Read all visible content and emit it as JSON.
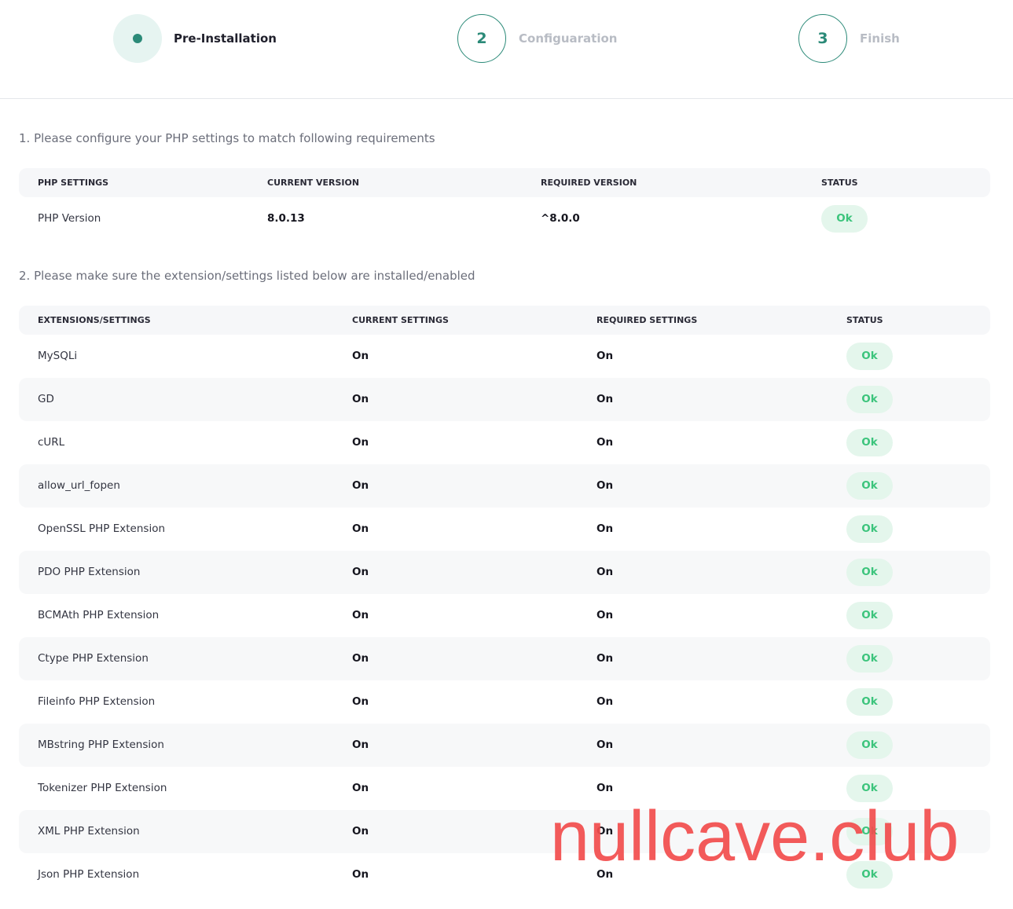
{
  "stepper": {
    "steps": [
      {
        "label": "Pre-Installation",
        "state": "active"
      },
      {
        "number": "2",
        "label": "Configuaration",
        "state": "pending"
      },
      {
        "number": "3",
        "label": "Finish",
        "state": "pending"
      }
    ]
  },
  "php_section": {
    "title": "1.  Please configure your PHP settings to match following requirements",
    "headers": [
      "PHP SETTINGS",
      "CURRENT VERSION",
      "REQUIRED VERSION",
      "STATUS"
    ],
    "row": {
      "setting": "PHP Version",
      "current": "8.0.13",
      "required": "^8.0.0",
      "status": "Ok"
    }
  },
  "ext_section": {
    "title": "2. Please make sure the extension/settings listed below are installed/enabled",
    "headers": [
      "EXTENSIONS/SETTINGS",
      "CURRENT SETTINGS",
      "REQUIRED SETTINGS",
      "STATUS"
    ],
    "rows": [
      {
        "name": "MySQLi",
        "current": "On",
        "required": "On",
        "status": "Ok"
      },
      {
        "name": "GD",
        "current": "On",
        "required": "On",
        "status": "Ok"
      },
      {
        "name": "cURL",
        "current": "On",
        "required": "On",
        "status": "Ok"
      },
      {
        "name": "allow_url_fopen",
        "current": "On",
        "required": "On",
        "status": "Ok"
      },
      {
        "name": "OpenSSL PHP Extension",
        "current": "On",
        "required": "On",
        "status": "Ok"
      },
      {
        "name": "PDO PHP Extension",
        "current": "On",
        "required": "On",
        "status": "Ok"
      },
      {
        "name": "BCMAth PHP Extension",
        "current": "On",
        "required": "On",
        "status": "Ok"
      },
      {
        "name": "Ctype PHP Extension",
        "current": "On",
        "required": "On",
        "status": "Ok"
      },
      {
        "name": "Fileinfo PHP Extension",
        "current": "On",
        "required": "On",
        "status": "Ok"
      },
      {
        "name": "MBstring PHP Extension",
        "current": "On",
        "required": "On",
        "status": "Ok"
      },
      {
        "name": "Tokenizer PHP Extension",
        "current": "On",
        "required": "On",
        "status": "Ok"
      },
      {
        "name": "XML PHP Extension",
        "current": "On",
        "required": "On",
        "status": "Ok"
      },
      {
        "name": "Json PHP Extension",
        "current": "On",
        "required": "On",
        "status": "Ok"
      }
    ]
  },
  "watermark": "nullcave.club",
  "colors": {
    "accent": "#2b8a78",
    "ok_text": "#3cc47c",
    "ok_bg": "#e4f6ec",
    "watermark": "#f24d4d"
  }
}
